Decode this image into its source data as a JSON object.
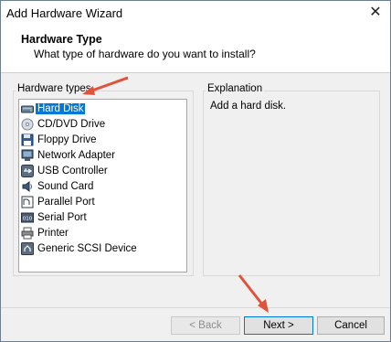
{
  "window": {
    "title": "Add Hardware Wizard"
  },
  "header": {
    "title": "Hardware Type",
    "subtitle": "What type of hardware do you want to install?"
  },
  "hardware_list": {
    "label": "Hardware types",
    "items": [
      {
        "label": "Hard Disk",
        "icon": "hard-disk-icon",
        "selected": true
      },
      {
        "label": "CD/DVD Drive",
        "icon": "cd-dvd-icon",
        "selected": false
      },
      {
        "label": "Floppy Drive",
        "icon": "floppy-icon",
        "selected": false
      },
      {
        "label": "Network Adapter",
        "icon": "network-adapter-icon",
        "selected": false
      },
      {
        "label": "USB Controller",
        "icon": "usb-icon",
        "selected": false
      },
      {
        "label": "Sound Card",
        "icon": "sound-card-icon",
        "selected": false
      },
      {
        "label": "Parallel Port",
        "icon": "parallel-port-icon",
        "selected": false
      },
      {
        "label": "Serial Port",
        "icon": "serial-port-icon",
        "selected": false
      },
      {
        "label": "Printer",
        "icon": "printer-icon",
        "selected": false
      },
      {
        "label": "Generic SCSI Device",
        "icon": "scsi-device-icon",
        "selected": false
      }
    ]
  },
  "explanation": {
    "label": "Explanation",
    "text": "Add a hard disk."
  },
  "buttons": {
    "back": "< Back",
    "next": "Next >",
    "cancel": "Cancel"
  },
  "colors": {
    "selection": "#0078d7",
    "annotation_arrow": "#e0533b"
  }
}
